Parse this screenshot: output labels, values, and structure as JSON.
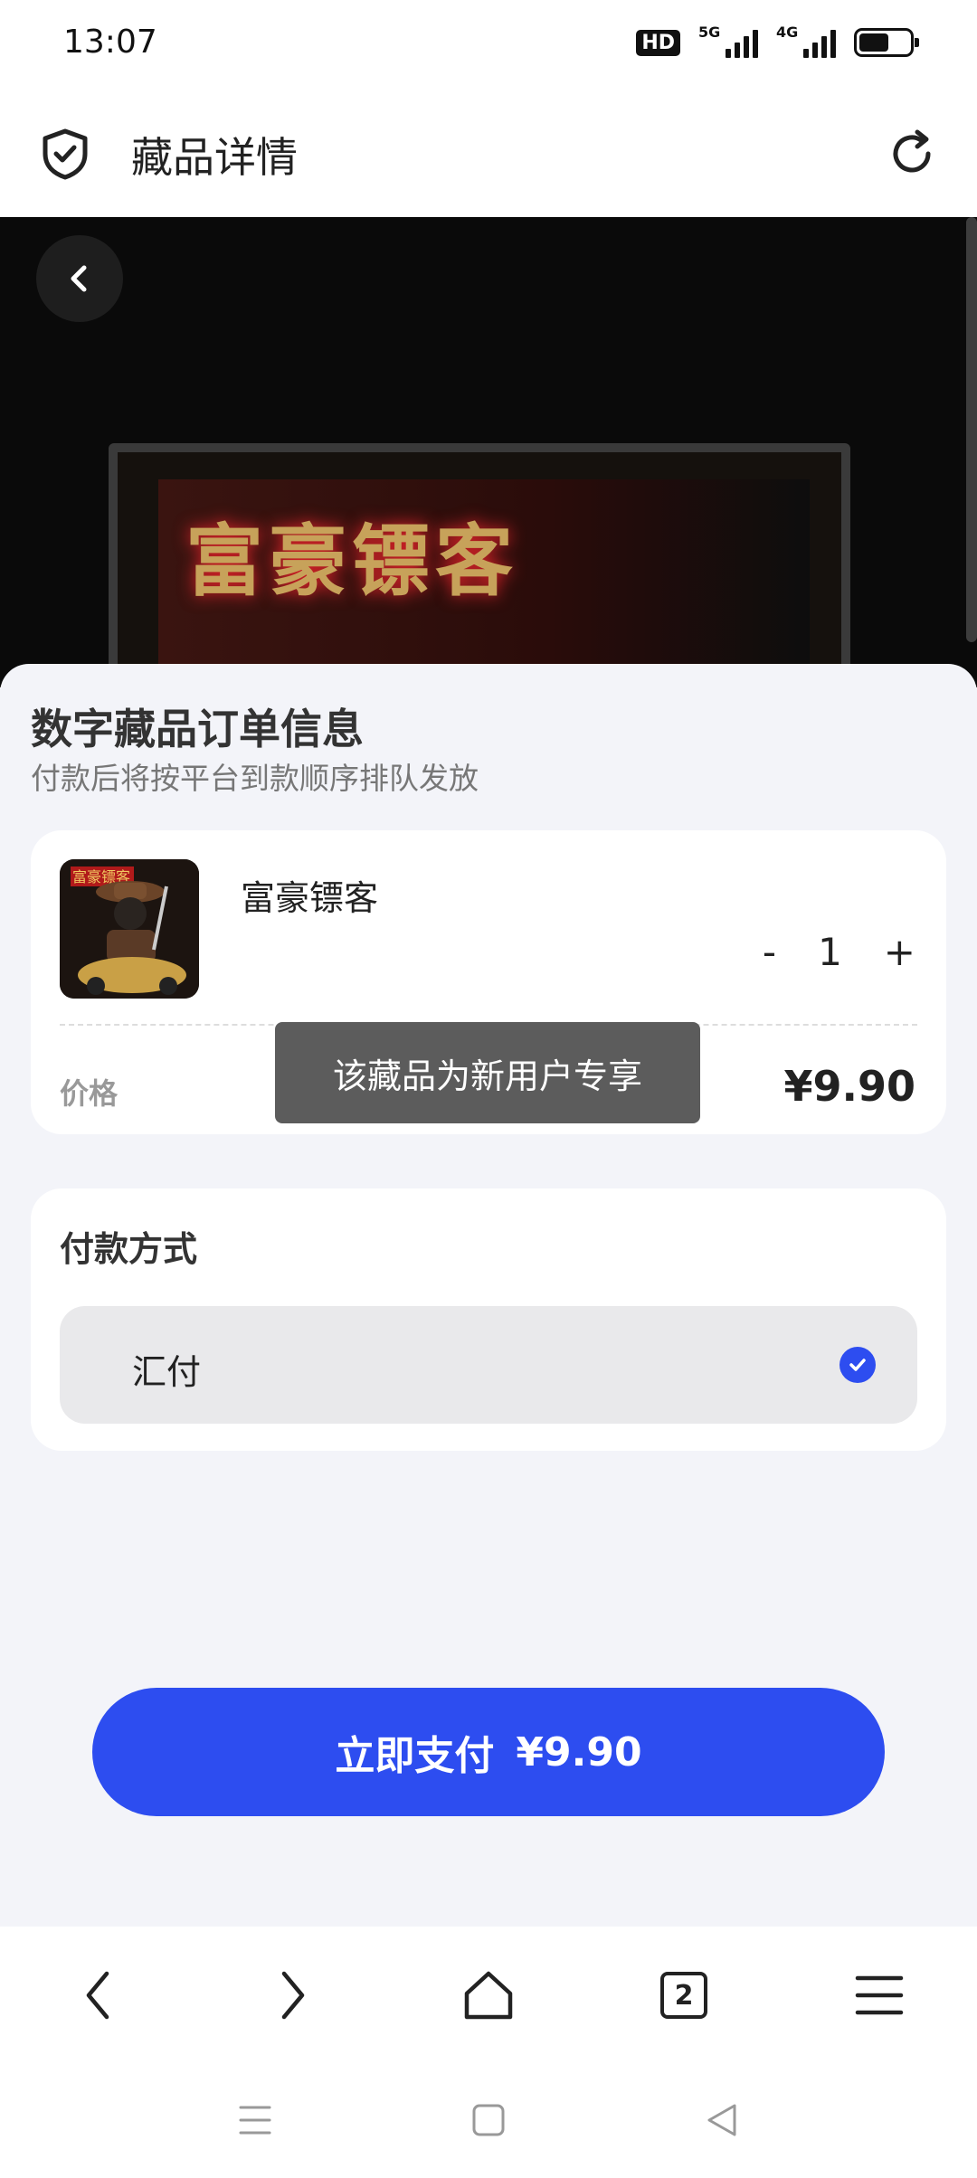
{
  "status_bar": {
    "time": "13:07",
    "hd_badge": "HD",
    "network_1": "5G",
    "network_2": "4G",
    "battery_level": 0.6
  },
  "header": {
    "title": "藏品详情",
    "left_icon": "shield-check-icon",
    "right_icon": "refresh-icon"
  },
  "hero": {
    "screen_text": "富豪镖客",
    "back_icon": "chevron-left-icon"
  },
  "order": {
    "title": "数字藏品订单信息",
    "subtitle": "付款后将按平台到款顺序排队发放",
    "product": {
      "name": "富豪镖客",
      "thumb_text": "富豪镖客",
      "quantity": "1",
      "decrement_label": "-",
      "increment_label": "+"
    },
    "price_label": "价格",
    "price_value": "¥9.90"
  },
  "toast": {
    "text": "该藏品为新用户专享"
  },
  "payment": {
    "title": "付款方式",
    "option_label": "汇付",
    "selected": true,
    "accent_color": "#2d4df0"
  },
  "pay_button": {
    "label": "立即支付",
    "amount": "¥9.90"
  },
  "browser_bar": {
    "back_icon": "chevron-left-icon",
    "forward_icon": "chevron-right-icon",
    "home_icon": "home-icon",
    "tab_count": "2",
    "menu_icon": "menu-icon"
  },
  "system_nav": {
    "recent_icon": "recent-apps-icon",
    "home_icon": "square-home-icon",
    "back_icon": "triangle-back-icon"
  }
}
